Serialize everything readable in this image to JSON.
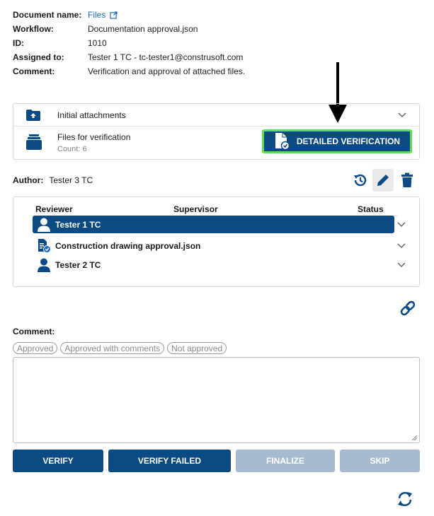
{
  "info": {
    "document_name_label": "Document name:",
    "document_name_value": "Files",
    "workflow_label": "Workflow:",
    "workflow_value": "Documentation approval.json",
    "id_label": "ID:",
    "id_value": "1010",
    "assigned_label": "Assigned to:",
    "assigned_value": "Tester 1 TC - tc-tester1@construsoft.com",
    "comment_label": "Comment:",
    "comment_value": "Verification and approval of attached files."
  },
  "attachments": {
    "initial_label": "Initial attachments",
    "files_label": "Files for verification",
    "files_count": "Count: 6",
    "detail_button": "DETAILED VERIFICATION"
  },
  "author": {
    "label": "Author:",
    "value": "Tester 3 TC"
  },
  "reviewers": {
    "headers": {
      "reviewer": "Reviewer",
      "supervisor": "Supervisor",
      "status": "Status"
    },
    "rows": [
      {
        "label": "Tester 1 TC",
        "icon": "person-icon"
      },
      {
        "label": "Construction drawing approval.json",
        "icon": "workflow-file-icon"
      },
      {
        "label": "Tester 2 TC",
        "icon": "person-icon"
      }
    ]
  },
  "comment": {
    "label": "Comment:",
    "chips": [
      "Approved",
      "Approved with comments",
      "Not approved"
    ],
    "value": ""
  },
  "actions": {
    "verify": "VERIFY",
    "verify_failed": "VERIFY FAILED",
    "finalize": "FINALIZE",
    "skip": "SKIP"
  },
  "colors": {
    "primary": "#0b4a83",
    "disabled": "#a6bbd2",
    "highlight_border": "#5ddc5d",
    "link": "#1a6fc4"
  }
}
